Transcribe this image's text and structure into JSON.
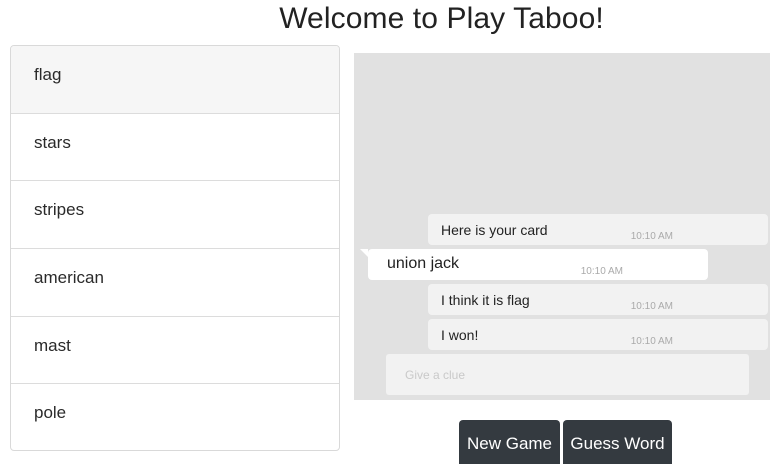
{
  "header": {
    "title": "Welcome to Play Taboo!"
  },
  "card": {
    "words": [
      "flag",
      "stars",
      "stripes",
      "american",
      "mast",
      "pole"
    ]
  },
  "chat": {
    "messages": [
      {
        "side": "right",
        "text": "Here is your card",
        "time": "10:10 AM"
      },
      {
        "side": "left",
        "text": "union jack",
        "time": "10:10 AM"
      },
      {
        "side": "right",
        "text": "I think it is flag",
        "time": "10:10 AM"
      },
      {
        "side": "right",
        "text": "I won!",
        "time": "10:10 AM"
      }
    ],
    "input": {
      "placeholder": "Give a clue",
      "value": ""
    }
  },
  "actions": {
    "new_game_label": "New Game",
    "guess_word_label": "Guess Word"
  },
  "colors": {
    "chat_bg": "#e1e1e1",
    "button_bg": "#343a40"
  }
}
